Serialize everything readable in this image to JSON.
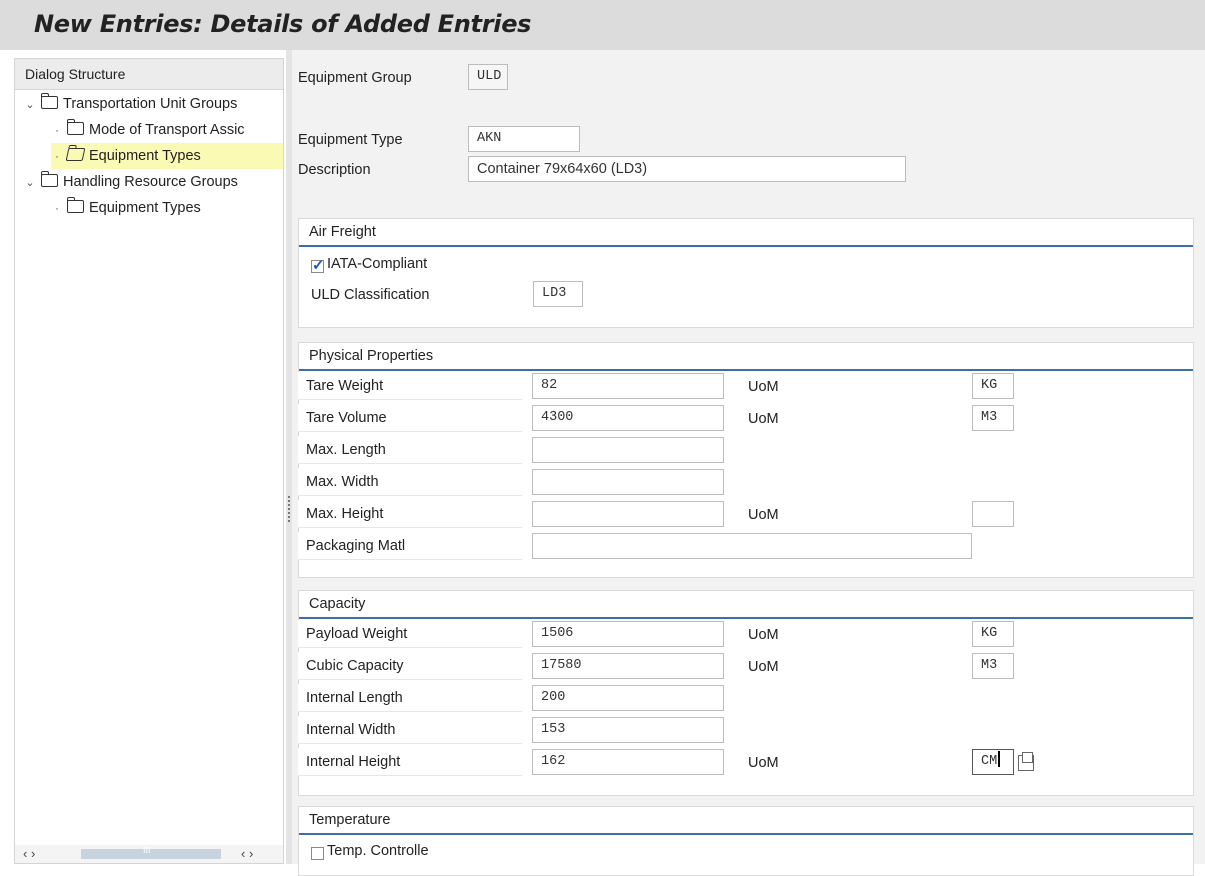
{
  "title": "New Entries: Details of Added Entries",
  "left_panel": {
    "header": "Dialog Structure",
    "tree": [
      {
        "label": "Transportation Unit Groups",
        "level": 0,
        "expanded": true
      },
      {
        "label": "Mode of Transport Assic",
        "level": 1
      },
      {
        "label": "Equipment Types",
        "level": 1,
        "selected": true
      },
      {
        "label": "Handling Resource Groups",
        "level": 0,
        "expanded": true
      },
      {
        "label": "Equipment Types",
        "level": 1
      }
    ],
    "scroll_left": "‹ ›",
    "scroll_thumb": "III",
    "scroll_right": "‹ ›"
  },
  "header_fields": {
    "equipment_group_label": "Equipment Group",
    "equipment_group_value": "ULD",
    "equipment_type_label": "Equipment Type",
    "equipment_type_value": "AKN",
    "description_label": "Description",
    "description_value": "Container  79x64x60 (LD3)"
  },
  "air_freight": {
    "title": "Air Freight",
    "iata_label": "IATA-Compliant",
    "iata_checked": true,
    "uld_class_label": "ULD Classification",
    "uld_class_value": "LD3"
  },
  "physical": {
    "title": "Physical Properties",
    "rows": [
      {
        "label": "Tare Weight",
        "value": "82",
        "uom_label": "UoM",
        "uom": "KG"
      },
      {
        "label": "Tare Volume",
        "value": "4300",
        "uom_label": "UoM",
        "uom": "M3"
      },
      {
        "label": "Max. Length",
        "value": ""
      },
      {
        "label": "Max. Width",
        "value": ""
      },
      {
        "label": "Max. Height",
        "value": "",
        "uom_label": "UoM",
        "uom": ""
      },
      {
        "label": "Packaging Matl",
        "value": ""
      }
    ]
  },
  "capacity": {
    "title": "Capacity",
    "rows": [
      {
        "label": "Payload Weight",
        "value": "1506",
        "uom_label": "UoM",
        "uom": "KG"
      },
      {
        "label": "Cubic Capacity",
        "value": "17580",
        "uom_label": "UoM",
        "uom": "M3"
      },
      {
        "label": "Internal Length",
        "value": "200"
      },
      {
        "label": "Internal Width",
        "value": "153"
      },
      {
        "label": "Internal Height",
        "value": "162",
        "uom_label": "UoM",
        "uom": "CM"
      }
    ]
  },
  "temperature": {
    "title": "Temperature",
    "temp_label": "Temp. Controlle",
    "temp_checked": false
  },
  "colors": {
    "selected_row": "#fafab5",
    "section_rule": "#3c6fa5",
    "check_mark": "#1c5fb3"
  }
}
